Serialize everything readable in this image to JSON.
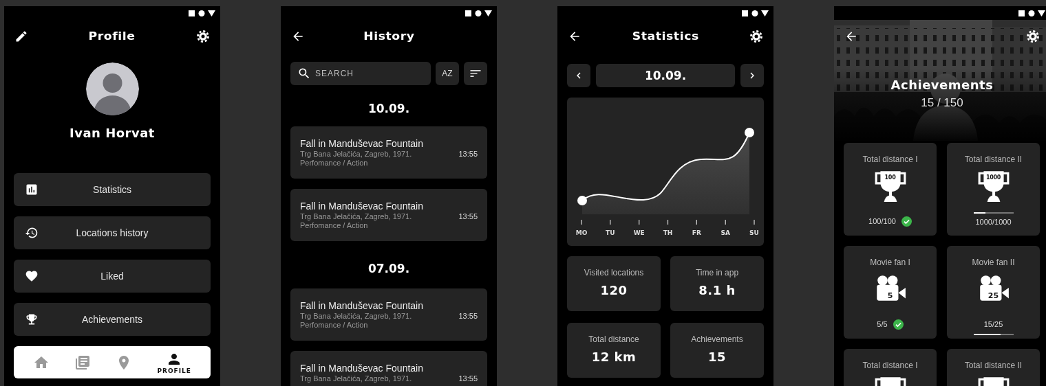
{
  "profile": {
    "title": "Profile",
    "name": "Ivan Horvat",
    "menu": [
      {
        "kind": "statistics",
        "label": "Statistics"
      },
      {
        "kind": "history",
        "label": "Locations history"
      },
      {
        "kind": "liked",
        "label": "Liked"
      },
      {
        "kind": "achievements",
        "label": "Achievements"
      }
    ],
    "nav": [
      {
        "kind": "home",
        "selected": false
      },
      {
        "kind": "news",
        "selected": false
      },
      {
        "kind": "location",
        "selected": false
      },
      {
        "kind": "profile",
        "selected": true,
        "label": "PROFILE"
      }
    ]
  },
  "history": {
    "title": "History",
    "search": {
      "placeholder": "SEARCH"
    },
    "sort_label": "AZ",
    "groups": [
      {
        "date": "10.09.",
        "entries": [
          {
            "title": "Fall in Manduševac Fountain",
            "address": "Trg Bana Jelačića, Zagreb, 1971.",
            "category": "Perfomance / Action",
            "time": "13:55"
          },
          {
            "title": "Fall in Manduševac Fountain",
            "address": "Trg Bana Jelačića, Zagreb, 1971.",
            "category": "Perfomance / Action",
            "time": "13:55"
          }
        ]
      },
      {
        "date": "07.09.",
        "entries": [
          {
            "title": "Fall in Manduševac Fountain",
            "address": "Trg Bana Jelačića, Zagreb, 1971.",
            "category": "Perfomance / Action",
            "time": "13:55"
          },
          {
            "title": "Fall in Manduševac Fountain",
            "address": "Trg Bana Jelačića, Zagreb, 1971.",
            "time": "13:55"
          }
        ]
      }
    ]
  },
  "statistics": {
    "title": "Statistics",
    "date": "10.09.",
    "chart": {
      "days": [
        "MO",
        "TU",
        "WE",
        "TH",
        "FR",
        "SA",
        "SU"
      ]
    },
    "stats": [
      {
        "label": "Visited locations",
        "value": "120"
      },
      {
        "label": "Time in app",
        "value": "8.1 h"
      },
      {
        "label": "Total distance",
        "value": "12 km"
      },
      {
        "label": "Achievements",
        "value": "15"
      }
    ]
  },
  "achievements": {
    "title": "Achievements",
    "count": "15 / 150",
    "items": [
      {
        "kind": "trophy",
        "title": "Total distance I",
        "badge": "100",
        "progress": "100/100",
        "completed": true
      },
      {
        "kind": "trophy",
        "title": "Total distance II",
        "badge": "1000",
        "progress": "1000/1000",
        "completed": false,
        "level": 0.3,
        "bar_above": true
      },
      {
        "kind": "camera",
        "title": "Movie fan I",
        "badge": "5",
        "progress": "5/5",
        "completed": true
      },
      {
        "kind": "camera",
        "title": "Movie fan II",
        "badge": "25",
        "progress": "15/25",
        "completed": false,
        "level": 0.68,
        "bar_above": false
      },
      {
        "kind": "trophy",
        "title": "Total distance I"
      },
      {
        "kind": "trophy",
        "title": "Total distance II"
      }
    ]
  }
}
